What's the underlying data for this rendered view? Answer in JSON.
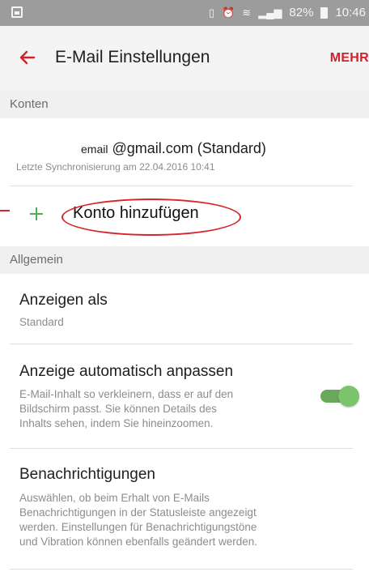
{
  "status_bar": {
    "icons": [
      "notification-icon",
      "vibrate-icon",
      "alarm-icon",
      "wifi-icon",
      "signal-icon",
      "battery-icon"
    ],
    "battery": "82%",
    "time": "10:46"
  },
  "app_bar": {
    "back_icon": "arrow-left-icon",
    "title": "E-Mail Einstellungen",
    "more_label": "MEHR",
    "accent_color": "#d0212b"
  },
  "sections": {
    "accounts_header": "Konten",
    "general_header": "Allgemein"
  },
  "account": {
    "email_local": "email",
    "email_domain": "@gmail.com",
    "default_tag": "(Standard)",
    "sync_text": "Letzte Synchronisierung am 22.04.2016 10:41"
  },
  "add_account": {
    "icon": "plus-icon",
    "label": "Konto hinzufügen"
  },
  "settings": [
    {
      "title": "Anzeigen als",
      "subtitle": "Standard"
    },
    {
      "title": "Anzeige automatisch anpassen",
      "subtitle_lines": [
        "E-Mail-Inhalt so verkleinern, dass er auf den",
        "Bildschirm passt. Sie können Details des",
        "Inhalts sehen, indem Sie hineinzoomen."
      ],
      "toggle_on": true
    },
    {
      "title": "Benachrichtigungen",
      "subtitle_lines": [
        "Auswählen, ob beim Erhalt von E-Mails",
        "Benachrichtigungen in der Statusleiste angezeigt",
        "werden. Einstellungen für Benachrichtigungstöne",
        "und Vibration können ebenfalls geändert werden."
      ]
    }
  ],
  "colors": {
    "toggle_on": "#6aa85b",
    "annotation": "#d6252d"
  }
}
